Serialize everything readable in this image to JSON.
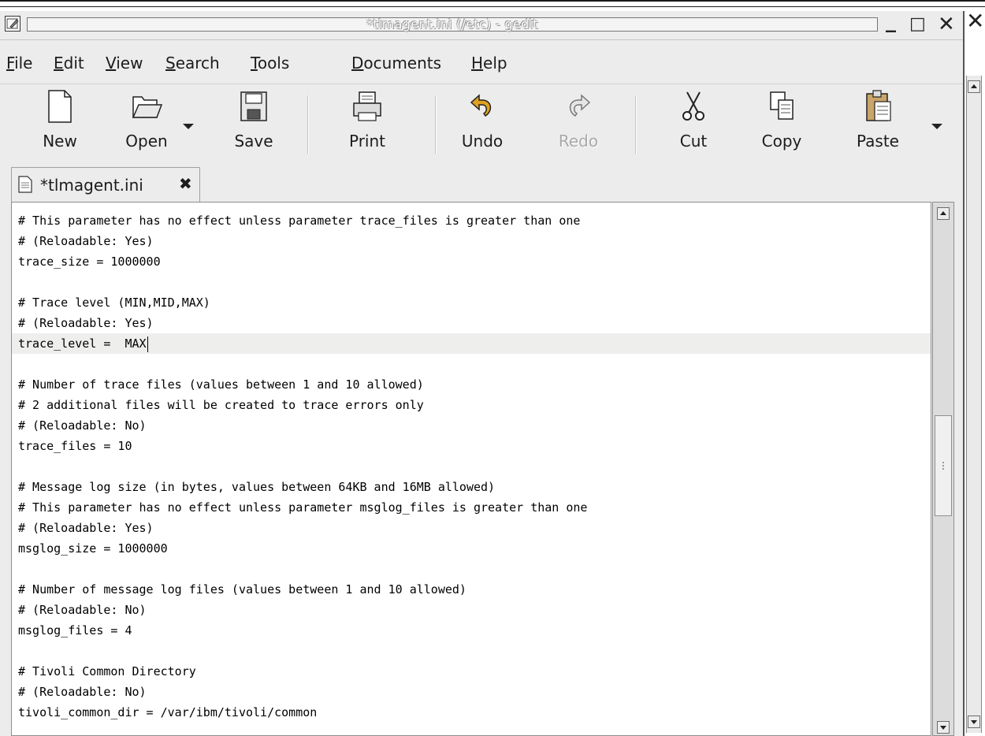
{
  "window": {
    "title": "*tlmagent.ini (/etc) - gedit",
    "minimize_glyph": "_",
    "maximize_glyph": "□",
    "close_glyph": "✕",
    "extra_close_glyph": "✕",
    "icon": "gedit-app-icon"
  },
  "menubar": {
    "items": [
      {
        "mnemonic": "F",
        "rest": "ile"
      },
      {
        "mnemonic": "E",
        "rest": "dit"
      },
      {
        "mnemonic": "V",
        "rest": "iew"
      },
      {
        "mnemonic": "S",
        "rest": "earch"
      },
      {
        "mnemonic": "T",
        "rest": "ools"
      },
      {
        "mnemonic": "D",
        "rest": "ocuments"
      },
      {
        "mnemonic": "H",
        "rest": "elp"
      }
    ]
  },
  "toolbar": {
    "new_label": "New",
    "open_label": "Open",
    "save_label": "Save",
    "print_label": "Print",
    "undo_label": "Undo",
    "redo_label": "Redo",
    "cut_label": "Cut",
    "copy_label": "Copy",
    "paste_label": "Paste"
  },
  "tabs": [
    {
      "label": "*tlmagent.ini",
      "close_glyph": "✖"
    }
  ],
  "editor": {
    "current_line_index": 6,
    "lines": [
      "# This parameter has no effect unless parameter trace_files is greater than one",
      "# (Reloadable: Yes)",
      "trace_size = 1000000",
      "",
      "# Trace level (MIN,MID,MAX)",
      "# (Reloadable: Yes)",
      "trace_level =  MAX",
      "",
      "# Number of trace files (values between 1 and 10 allowed)",
      "# 2 additional files will be created to trace errors only",
      "# (Reloadable: No)",
      "trace_files = 10",
      "",
      "# Message log size (in bytes, values between 64KB and 16MB allowed)",
      "# This parameter has no effect unless parameter msglog_files is greater than one",
      "# (Reloadable: Yes)",
      "msglog_size = 1000000",
      "",
      "# Number of message log files (values between 1 and 10 allowed)",
      "# (Reloadable: No)",
      "msglog_files = 4",
      "",
      "# Tivoli Common Directory",
      "# (Reloadable: No)",
      "tivoli_common_dir = /var/ibm/tivoli/common"
    ]
  }
}
